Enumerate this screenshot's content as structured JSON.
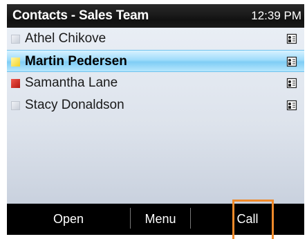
{
  "header": {
    "title": "Contacts - Sales Team",
    "time": "12:39 PM"
  },
  "contacts": [
    {
      "name": "Athel Chikove",
      "status_color": "#cdd3dc",
      "selected": false
    },
    {
      "name": "Martin Pedersen",
      "status_color": "#f5d321",
      "selected": true
    },
    {
      "name": "Samantha Lane",
      "status_color": "#c8281e",
      "selected": false
    },
    {
      "name": "Stacy Donaldson",
      "status_color": "#cdd3dc",
      "selected": false
    }
  ],
  "softkeys": {
    "open": "Open",
    "menu": "Menu",
    "call": "Call"
  },
  "icons": {
    "status": "presence-square-icon",
    "contact_card": "contact-card-icon"
  },
  "colors": {
    "selection": "#9fdcfb",
    "callout": "#f08a2a",
    "softkey_bar": "#000000"
  }
}
